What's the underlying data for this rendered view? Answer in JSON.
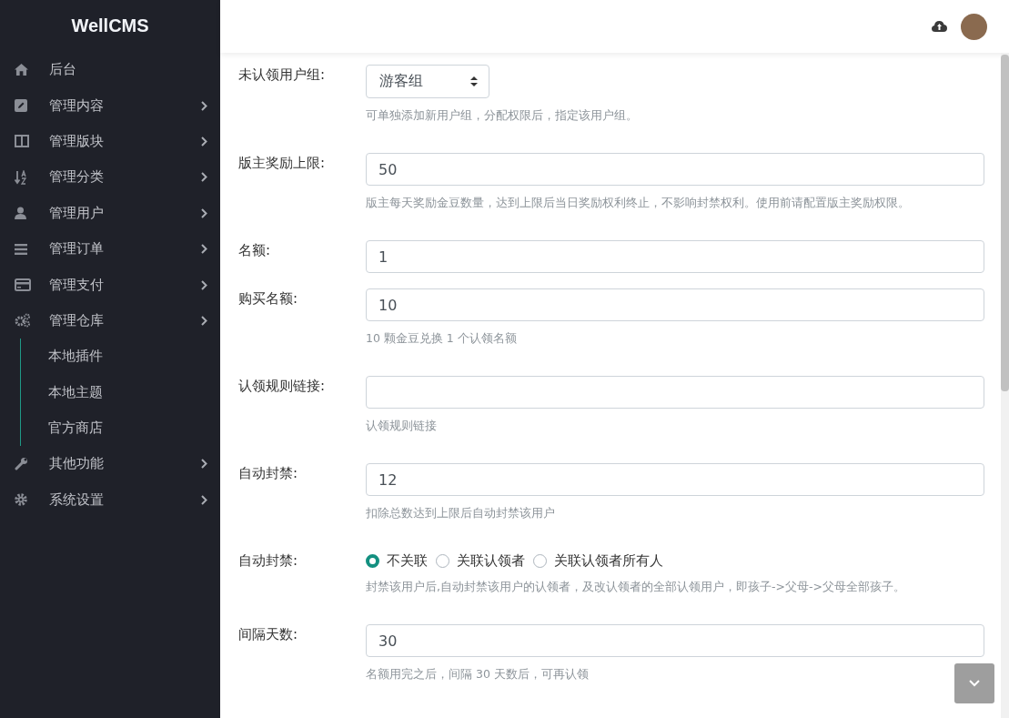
{
  "sidebar": {
    "logo": "WellCMS",
    "items": [
      {
        "label": "后台",
        "has_submenu": false
      },
      {
        "label": "管理内容",
        "has_submenu": true
      },
      {
        "label": "管理版块",
        "has_submenu": true
      },
      {
        "label": "管理分类",
        "has_submenu": true
      },
      {
        "label": "管理用户",
        "has_submenu": true
      },
      {
        "label": "管理订单",
        "has_submenu": true
      },
      {
        "label": "管理支付",
        "has_submenu": true
      },
      {
        "label": "管理仓库",
        "has_submenu": true,
        "children": [
          {
            "label": "本地插件"
          },
          {
            "label": "本地主题"
          },
          {
            "label": "官方商店"
          }
        ]
      },
      {
        "label": "其他功能",
        "has_submenu": true
      },
      {
        "label": "系统设置",
        "has_submenu": true
      }
    ]
  },
  "form": {
    "fields": [
      {
        "kind": "select",
        "label": "未认领用户组:",
        "value": "游客组",
        "help": "可单独添加新用户组，分配权限后，指定该用户组。"
      },
      {
        "kind": "input",
        "label": "版主奖励上限:",
        "value": "50",
        "help": "版主每天奖励金豆数量，达到上限后当日奖励权利终止，不影响封禁权利。使用前请配置版主奖励权限。"
      },
      {
        "kind": "input",
        "label": "名额:",
        "value": "1"
      },
      {
        "kind": "input",
        "label": "购买名额:",
        "value": "10",
        "help": "10 颗金豆兑换 1 个认领名额"
      },
      {
        "kind": "input",
        "label": "认领规则链接:",
        "help": "认领规则链接"
      },
      {
        "kind": "input",
        "label": "自动封禁:",
        "value": "12",
        "help": "扣除总数达到上限后自动封禁该用户"
      },
      {
        "kind": "radio",
        "label": "自动封禁:",
        "options": [
          {
            "label": "不关联",
            "selected": true
          },
          {
            "label": "关联认领者",
            "selected": false
          },
          {
            "label": "关联认领者所有人",
            "selected": false
          }
        ],
        "help": "封禁该用户后,自动封禁该用户的认领者，及改认领者的全部认领用户，即孩子->父母->父母全部孩子。"
      },
      {
        "kind": "input",
        "label": "间隔天数:",
        "value": "30",
        "help": "名额用完之后，间隔 30 天数后，可再认领"
      }
    ]
  }
}
